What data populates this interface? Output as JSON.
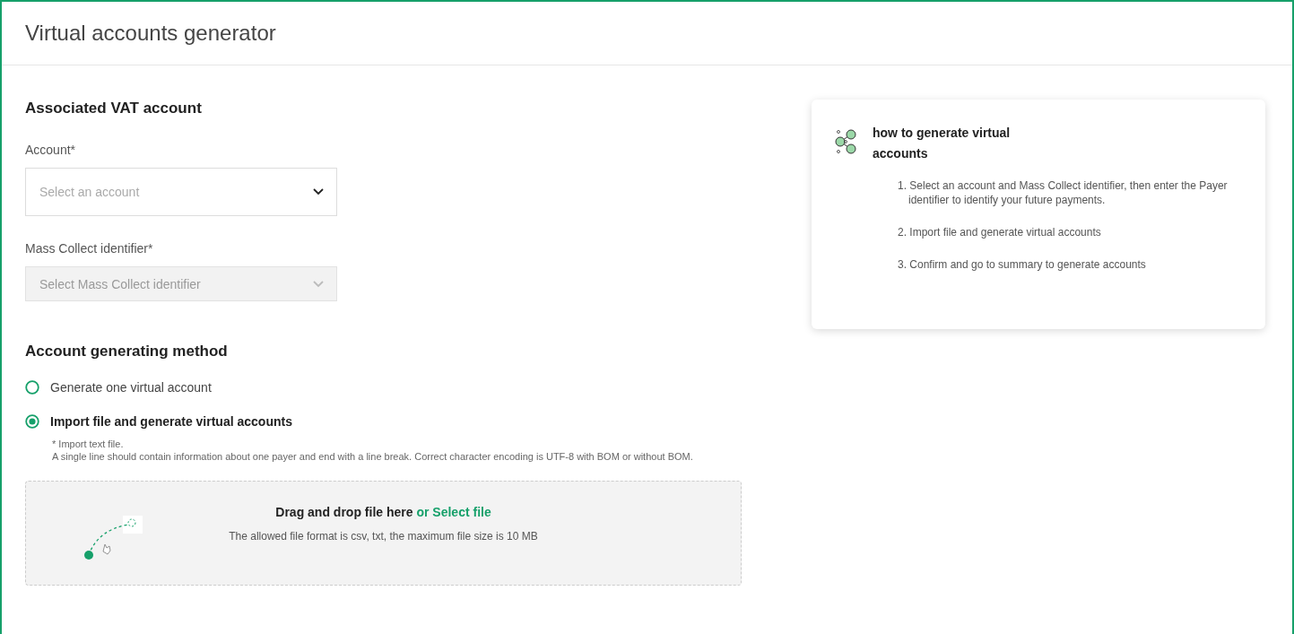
{
  "page": {
    "title": "Virtual accounts generator"
  },
  "vat_section": {
    "heading": "Associated VAT account",
    "fields": [
      {
        "label": "Account*",
        "placeholder": "Select an account",
        "disabled": false
      },
      {
        "label": "Mass Collect identifier*",
        "placeholder": "Select Mass Collect identifier",
        "disabled": true
      }
    ]
  },
  "method_section": {
    "heading": "Account generating method",
    "options": [
      {
        "label": "Generate one virtual account",
        "selected": false
      },
      {
        "label": "Import file and generate virtual accounts",
        "selected": true
      }
    ],
    "note": "* Import text file.",
    "description": "A single line should contain information about one payer and end with a line break. Correct character encoding is UTF-8 with BOM or without BOM."
  },
  "dropzone": {
    "text": "Drag and drop file here",
    "link": "or Select file",
    "hint": "The allowed file format is csv, txt, the maximum file size is 10 MB"
  },
  "help_card": {
    "title": "how to generate virtual accounts",
    "steps": [
      "1. Select an account and Mass Collect identifier, then enter the Payer identifier to identify your future payments.",
      "2. Import file and generate virtual accounts",
      "3. Confirm and go to summary to generate accounts"
    ]
  }
}
